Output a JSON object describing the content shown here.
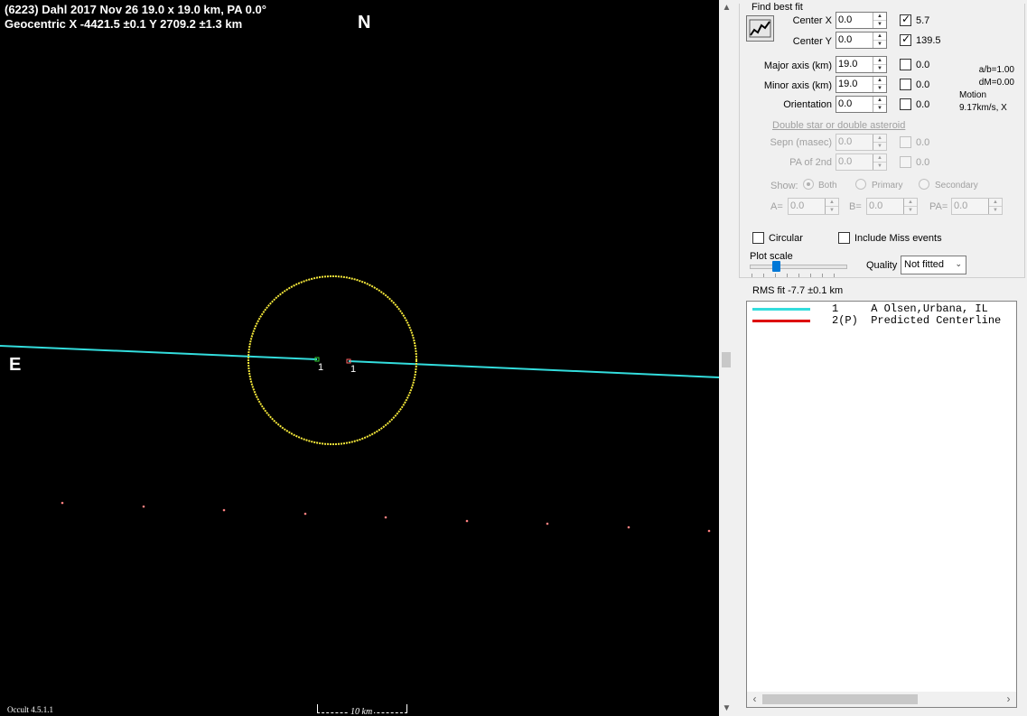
{
  "plot": {
    "title_line1": "(6223) Dahl  2017 Nov 26   19.0 x 19.0 km, PA 0.0°",
    "title_line2": "Geocentric  X  -4421.5 ±0.1  Y 2709.2 ±1.3 km",
    "north_label": "N",
    "east_label": "E",
    "chord_labels": [
      "1",
      "1"
    ],
    "version": "Occult 4.5.1.1",
    "scale_label": "10 km",
    "colors": {
      "background": "#000000",
      "ellipse": "#f5e83a",
      "chord": "#33dddd",
      "path_dots": "#ff8080",
      "chord_end_start": "#33cc33",
      "chord_end_stop": "#ff6666"
    }
  },
  "panel": {
    "group_title": "Find best fit",
    "fit_button_icon": "chart-fit-icon",
    "center_x": {
      "label": "Center X",
      "value": "0.0",
      "check_value": "5.7",
      "checked": true
    },
    "center_y": {
      "label": "Center Y",
      "value": "0.0",
      "check_value": "139.5",
      "checked": true
    },
    "major_axis": {
      "label": "Major axis (km)",
      "value": "19.0",
      "check_value": "0.0",
      "checked": false
    },
    "minor_axis": {
      "label": "Minor axis (km)",
      "value": "19.0",
      "check_value": "0.0",
      "checked": false
    },
    "orientation": {
      "label": "Orientation",
      "value": "0.0",
      "check_value": "0.0",
      "checked": false
    },
    "ab_ratio": "a/b=1.00",
    "dm": "dM=0.00",
    "motion_label": "Motion",
    "motion_value": "9.17km/s, X",
    "double_star_link": "Double star  or  double asteroid",
    "sepn": {
      "label": "Sepn (masec)",
      "value": "0.0",
      "check_value": "0.0"
    },
    "pa_2nd": {
      "label": "PA of 2nd",
      "value": "0.0",
      "check_value": "0.0"
    },
    "show_label": "Show:",
    "show_options": [
      "Both",
      "Primary",
      "Secondary"
    ],
    "a_field": {
      "label": "A=",
      "value": "0.0"
    },
    "b_field": {
      "label": "B=",
      "value": "0.0"
    },
    "pa_field": {
      "label": "PA=",
      "value": "0.0"
    },
    "circular_label": "Circular",
    "include_miss_label": "Include Miss events",
    "plot_scale_label": "Plot scale",
    "quality_label": "Quality",
    "quality_value": "Not fitted",
    "rms_fit": "RMS fit  -7.7 ±0.1 km",
    "legend": [
      {
        "num": "1     A Olsen,Urbana, IL",
        "color": "#33dddd"
      },
      {
        "num": "2(P)  Predicted Centerline",
        "color": "#dd0000"
      }
    ]
  }
}
